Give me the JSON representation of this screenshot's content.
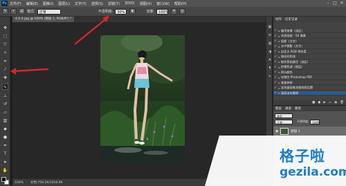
{
  "menubar": {
    "app_logo": "Ps",
    "items": [
      "文件(F)",
      "编辑(E)",
      "图像(I)",
      "图层(L)",
      "文字(Y)",
      "选择(S)",
      "滤镜(T)",
      "3D(D)",
      "视图(V)",
      "窗口(W)",
      "帮助(H)"
    ],
    "minimize": "–",
    "maximize": "□",
    "close": "✕"
  },
  "options": {
    "mode_label": "模式:",
    "mode_value": "正常",
    "opacity_label": "不透明度:",
    "opacity_value": "30%",
    "flow_label": "流量:",
    "flow_value": "100%"
  },
  "document": {
    "tab_title": "4,5-2.jpg @ 100% (图层 1, RGB/8*) *",
    "zoom": "100%",
    "doc_info": "文档:758.1K/1016.9K"
  },
  "actions_panel": {
    "tabs": [
      "动作",
      "历史记录"
    ],
    "items": [
      "顺序效果（选区）",
      "木质画框 - 50 像素",
      "投影（文字）",
      "水中倒影（文字）",
      "自定义 RGB 到灰度",
      "熔化的铅块",
      "制作剪贴路径（选区）",
      "棕褐色调（图层）",
      "四分颜色",
      "存储为 Photoshop PDF",
      "渐变映射",
      "混合器画笔克隆绘图设置",
      "画面淡化重照"
    ],
    "selected_index": 12
  },
  "layers_panel": {
    "tabs": [
      "图层",
      "通道",
      "路径"
    ],
    "kind_label": "类型",
    "blend_mode": "正常",
    "opacity_label": "不透明度:",
    "opacity_value": "100%",
    "layer_name": "图层 1"
  },
  "watermark": {
    "title": "格子啦",
    "url": "gezila.com"
  },
  "colors": {
    "arrow_red": "#d8262b",
    "watermark_blue": "#1f7ec2",
    "selection_blue": "#2c5b8e"
  }
}
